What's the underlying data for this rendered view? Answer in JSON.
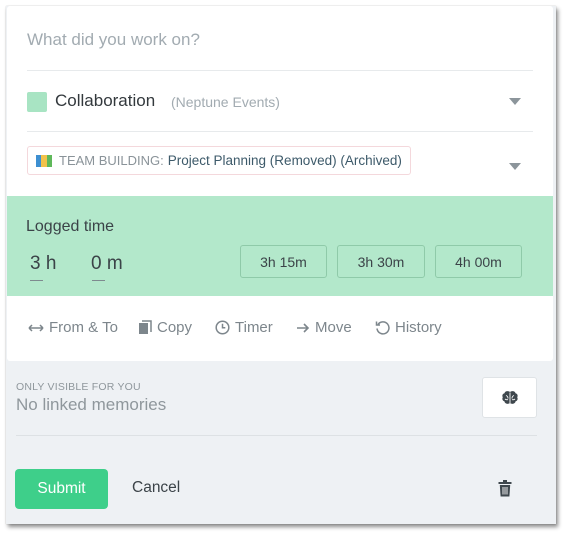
{
  "form": {
    "description_placeholder": "What did you work on?",
    "project": {
      "name": "Collaboration",
      "client": "(Neptune Events)",
      "color": "#a8e4c3"
    },
    "task": {
      "category": "TEAM BUILDING:",
      "name": "Project Planning (Removed) (Archived)",
      "icon": "map-icon"
    }
  },
  "logged_time": {
    "title": "Logged time",
    "hours": "3 h",
    "minutes": "0 m",
    "presets": [
      "3h 15m",
      "3h 30m",
      "4h 00m"
    ],
    "color": "#b3e8cb"
  },
  "actions": [
    {
      "label": "From & To",
      "icon": "arrows-horizontal-icon"
    },
    {
      "label": "Copy",
      "icon": "copy-icon"
    },
    {
      "label": "Timer",
      "icon": "clock-icon"
    },
    {
      "label": "Move",
      "icon": "arrow-right-icon"
    },
    {
      "label": "History",
      "icon": "history-icon"
    }
  ],
  "memories": {
    "visibility_label": "ONLY VISIBLE FOR YOU",
    "status": "No linked memories",
    "button_icon": "brain-icon"
  },
  "footer": {
    "submit_label": "Submit",
    "cancel_label": "Cancel",
    "delete_icon": "trash-icon",
    "accent": "#3ecf8a"
  }
}
